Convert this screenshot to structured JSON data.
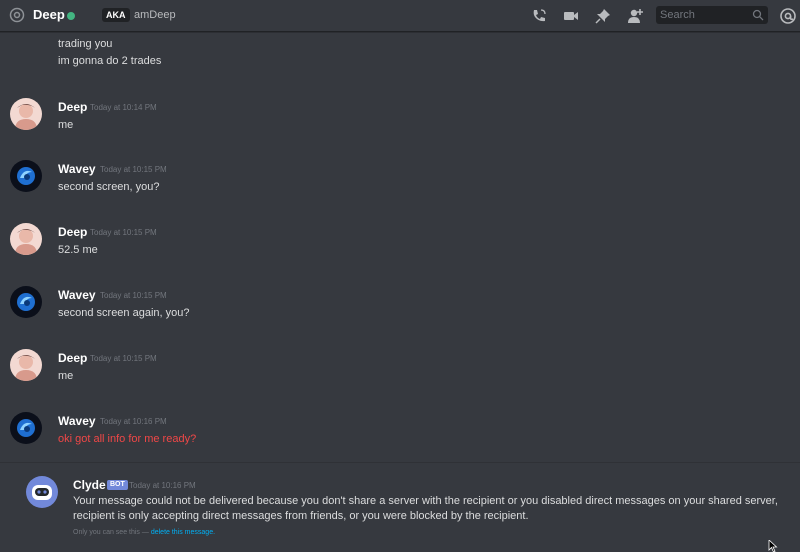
{
  "header": {
    "title": "Deep",
    "status_color": "#43b581",
    "aka_label": "AKA",
    "aka_name": "amDeep",
    "search_placeholder": "Search",
    "icons": [
      "call-icon",
      "video-icon",
      "pin-icon",
      "add-friend-icon",
      "search-icon",
      "mention-icon"
    ]
  },
  "continuation": [
    "trading you",
    "im gonna do 2 trades"
  ],
  "messages": [
    {
      "author": "Deep",
      "timestamp": "Today at 10:14 PM",
      "content": "me"
    },
    {
      "author": "Wavey",
      "timestamp": "Today at 10:15 PM",
      "content": "second screen, you?"
    },
    {
      "author": "Deep",
      "timestamp": "Today at 10:15 PM",
      "content": "52.5 me"
    },
    {
      "author": "Wavey",
      "timestamp": "Today at 10:15 PM",
      "content": "second screen again, you?"
    },
    {
      "author": "Deep",
      "timestamp": "Today at 10:15 PM",
      "content": "me"
    },
    {
      "author": "Wavey",
      "timestamp": "Today at 10:16 PM",
      "content": "oki got all info for me ready?",
      "failed": true
    }
  ],
  "clyde": {
    "author": "Clyde",
    "bot_tag": "BOT",
    "timestamp": "Today at 10:16 PM",
    "text": "Your message could not be delivered because you don't share a server with the recipient or you disabled direct messages on your shared server, recipient is only accepting direct messages from friends, or you were blocked by the recipient.",
    "note_prefix": "Only you can see this —",
    "note_link": "delete this message."
  },
  "colors": {
    "background": "#36393f",
    "error_text": "#f04747",
    "link": "#00b0f4",
    "bot_tag": "#7289da"
  }
}
